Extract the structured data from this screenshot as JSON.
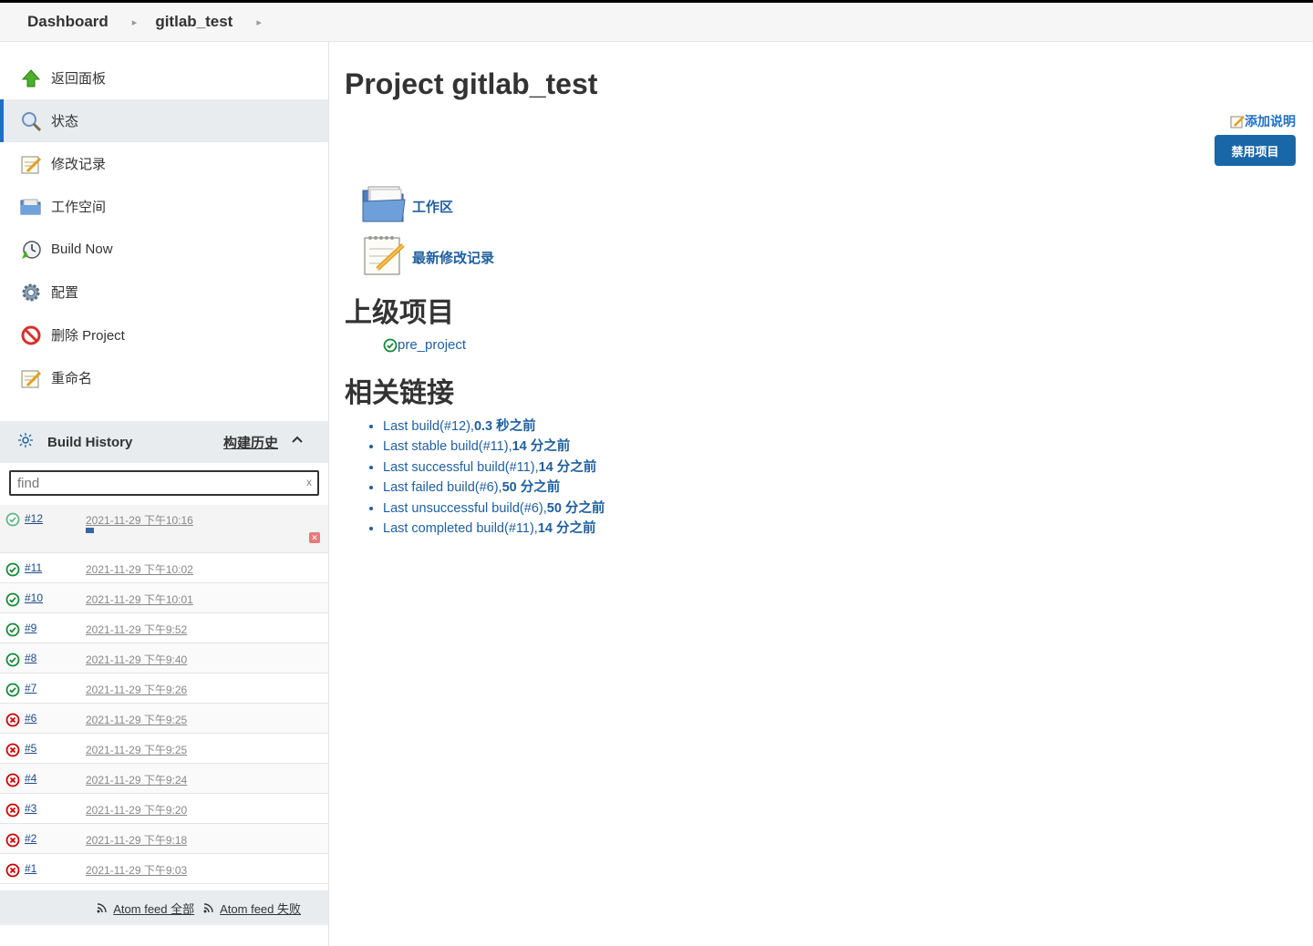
{
  "breadcrumb": {
    "items": [
      "Dashboard",
      "gitlab_test"
    ]
  },
  "sidebar": {
    "tasks": [
      {
        "label": "返回面板",
        "icon": "up-arrow-icon"
      },
      {
        "label": "状态",
        "icon": "magnifier-icon",
        "active": true
      },
      {
        "label": "修改记录",
        "icon": "notepad-icon"
      },
      {
        "label": "工作空间",
        "icon": "folder-icon"
      },
      {
        "label": "Build Now",
        "icon": "clock-icon"
      },
      {
        "label": "配置",
        "icon": "gear-icon"
      },
      {
        "label": "删除 Project",
        "icon": "no-entry-icon"
      },
      {
        "label": "重命名",
        "icon": "notepad-icon"
      }
    ]
  },
  "build_history": {
    "title": "Build History",
    "trend_label": "构建历史",
    "search_placeholder": "find",
    "clear_label": "x",
    "builds": [
      {
        "number": "#12",
        "date": "2021-11-29 下午10:16",
        "status": "running"
      },
      {
        "number": "#11",
        "date": "2021-11-29 下午10:02",
        "status": "success"
      },
      {
        "number": "#10",
        "date": "2021-11-29 下午10:01",
        "status": "success"
      },
      {
        "number": "#9",
        "date": "2021-11-29 下午9:52",
        "status": "success"
      },
      {
        "number": "#8",
        "date": "2021-11-29 下午9:40",
        "status": "success"
      },
      {
        "number": "#7",
        "date": "2021-11-29 下午9:26",
        "status": "success"
      },
      {
        "number": "#6",
        "date": "2021-11-29 下午9:25",
        "status": "failed"
      },
      {
        "number": "#5",
        "date": "2021-11-29 下午9:25",
        "status": "failed"
      },
      {
        "number": "#4",
        "date": "2021-11-29 下午9:24",
        "status": "failed"
      },
      {
        "number": "#3",
        "date": "2021-11-29 下午9:20",
        "status": "failed"
      },
      {
        "number": "#2",
        "date": "2021-11-29 下午9:18",
        "status": "failed"
      },
      {
        "number": "#1",
        "date": "2021-11-29 下午9:03",
        "status": "failed"
      }
    ],
    "feed_all": "Atom feed 全部",
    "feed_failed": "Atom feed 失败"
  },
  "main": {
    "title": "Project gitlab_test",
    "add_description": "添加说明",
    "disable_button": "禁用项目",
    "workspace_link": "工作区",
    "changes_link": "最新修改记录",
    "upstream_heading": "上级项目",
    "upstream_project": "pre_project",
    "related_heading": "相关链接",
    "related_links": [
      {
        "text": "Last build(#12),",
        "suffix": "0.3 秒之前"
      },
      {
        "text": "Last stable build(#11),",
        "suffix": "14 分之前"
      },
      {
        "text": "Last successful build(#11),",
        "suffix": "14 分之前"
      },
      {
        "text": "Last failed build(#6),",
        "suffix": "50 分之前"
      },
      {
        "text": "Last unsuccessful build(#6),",
        "suffix": "50 分之前"
      },
      {
        "text": "Last completed build(#11),",
        "suffix": "14 分之前"
      }
    ]
  },
  "colors": {
    "accent": "#1a67a8",
    "link": "#1f5fa0",
    "success": "#138a36",
    "failure": "#cc0000"
  }
}
